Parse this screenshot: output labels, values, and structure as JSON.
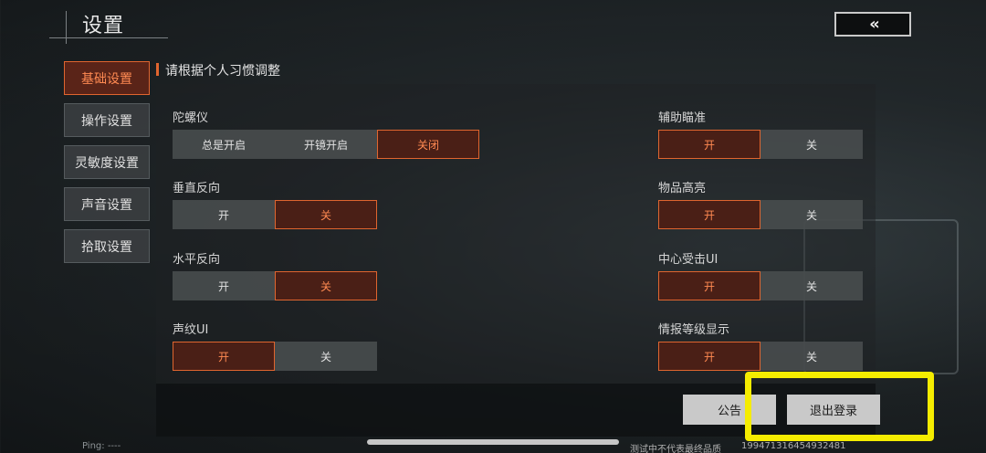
{
  "header": {
    "title": "设置",
    "back_icon": "double-chevron-left-icon",
    "back_glyph": "«"
  },
  "sidebar": {
    "items": [
      {
        "label": "基础设置",
        "active": true
      },
      {
        "label": "操作设置",
        "active": false
      },
      {
        "label": "灵敏度设置",
        "active": false
      },
      {
        "label": "声音设置",
        "active": false
      },
      {
        "label": "拾取设置",
        "active": false
      }
    ]
  },
  "section_title": "请根据个人习惯调整",
  "settings": {
    "gyroscope": {
      "label": "陀螺仪",
      "options": [
        "总是开启",
        "开镜开启",
        "关闭"
      ],
      "selected": 2
    },
    "vertical_invert": {
      "label": "垂直反向",
      "options": [
        "开",
        "关"
      ],
      "selected": 1
    },
    "horizontal_invert": {
      "label": "水平反向",
      "options": [
        "开",
        "关"
      ],
      "selected": 1
    },
    "voiceprint_ui": {
      "label": "声纹UI",
      "options": [
        "开",
        "关"
      ],
      "selected": 0
    },
    "aim_assist": {
      "label": "辅助瞄准",
      "options": [
        "开",
        "关"
      ],
      "selected": 0
    },
    "item_highlight": {
      "label": "物品高亮",
      "options": [
        "开",
        "关"
      ],
      "selected": 0
    },
    "center_hit_ui": {
      "label": "中心受击UI",
      "options": [
        "开",
        "关"
      ],
      "selected": 0
    },
    "intel_level_display": {
      "label": "情报等级显示",
      "options": [
        "开",
        "关"
      ],
      "selected": 0
    }
  },
  "footer": {
    "notice_label": "公告",
    "logout_label": "退出登录",
    "ping": "Ping: ----",
    "test_note": "测试中不代表最终品质",
    "uid": "1994713164549324​81"
  },
  "colors": {
    "accent": "#e0652f",
    "highlight": "#f5ec00"
  }
}
